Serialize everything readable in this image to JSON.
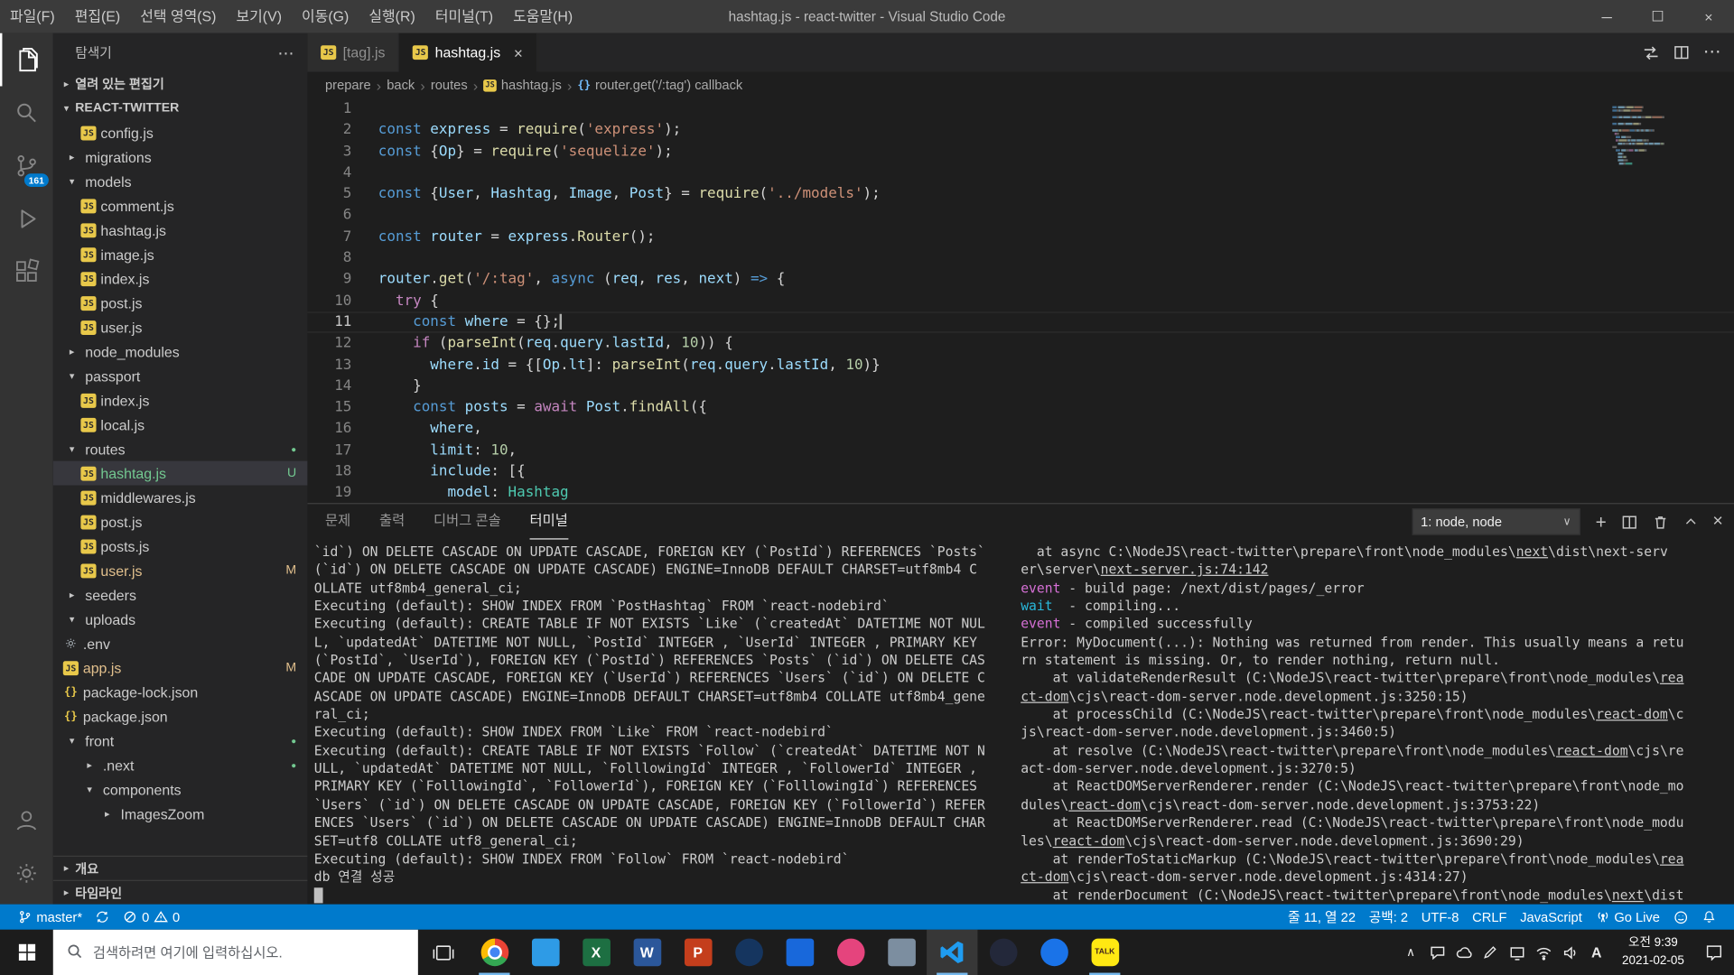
{
  "colors": {
    "accent": "#007acc",
    "untracked": "#73c991",
    "modified": "#e2c08d"
  },
  "title_bar": {
    "menus": [
      "파일(F)",
      "편집(E)",
      "선택 영역(S)",
      "보기(V)",
      "이동(G)",
      "실행(R)",
      "터미널(T)",
      "도움말(H)"
    ],
    "title": "hashtag.js - react-twitter - Visual Studio Code",
    "window_controls": [
      "minimize",
      "maximize",
      "close"
    ]
  },
  "activity_bar": {
    "items": [
      {
        "name": "explorer",
        "active": true
      },
      {
        "name": "search"
      },
      {
        "name": "source-control",
        "badge": "161"
      },
      {
        "name": "run-and-debug"
      },
      {
        "name": "extensions"
      }
    ],
    "bottom": [
      {
        "name": "account"
      },
      {
        "name": "manage"
      }
    ]
  },
  "sidebar": {
    "title": "탐색기",
    "sections": {
      "open_editors": "열려 있는 편집기",
      "outline": "개요",
      "timeline": "타임라인"
    },
    "root": "REACT-TWITTER",
    "tree": [
      {
        "label": "config.js",
        "icon": "js",
        "indent": 2
      },
      {
        "label": "migrations",
        "chevron": "collapsed",
        "indent": 1
      },
      {
        "label": "models",
        "chevron": "expanded",
        "indent": 1
      },
      {
        "label": "comment.js",
        "icon": "js",
        "indent": 2
      },
      {
        "label": "hashtag.js",
        "icon": "js",
        "indent": 2
      },
      {
        "label": "image.js",
        "icon": "js",
        "indent": 2
      },
      {
        "label": "index.js",
        "icon": "js",
        "indent": 2
      },
      {
        "label": "post.js",
        "icon": "js",
        "indent": 2
      },
      {
        "label": "user.js",
        "icon": "js",
        "indent": 2
      },
      {
        "label": "node_modules",
        "chevron": "collapsed",
        "indent": 1
      },
      {
        "label": "passport",
        "chevron": "expanded",
        "indent": 1
      },
      {
        "label": "index.js",
        "icon": "js",
        "indent": 2
      },
      {
        "label": "local.js",
        "icon": "js",
        "indent": 2
      },
      {
        "label": "routes",
        "chevron": "expanded",
        "indent": 1,
        "dot": true
      },
      {
        "label": "hashtag.js",
        "icon": "js",
        "indent": 2,
        "selected": true,
        "badge": "U",
        "state": "untracked"
      },
      {
        "label": "middlewares.js",
        "icon": "js",
        "indent": 2
      },
      {
        "label": "post.js",
        "icon": "js",
        "indent": 2
      },
      {
        "label": "posts.js",
        "icon": "js",
        "indent": 2
      },
      {
        "label": "user.js",
        "icon": "js",
        "indent": 2,
        "badge": "M",
        "state": "modified"
      },
      {
        "label": "seeders",
        "chevron": "collapsed",
        "indent": 1
      },
      {
        "label": "uploads",
        "chevron": "expanded",
        "indent": 1
      },
      {
        "label": ".env",
        "icon": "gear",
        "indent": 1
      },
      {
        "label": "app.js",
        "icon": "js",
        "indent": 1,
        "badge": "M",
        "state": "modified"
      },
      {
        "label": "package-lock.json",
        "icon": "json",
        "indent": 1
      },
      {
        "label": "package.json",
        "icon": "json",
        "indent": 1
      },
      {
        "label": "front",
        "chevron": "expanded",
        "indent": 1,
        "dot": true
      },
      {
        "label": ".next",
        "chevron": "collapsed",
        "indent": 2,
        "dot": true
      },
      {
        "label": "components",
        "chevron": "expanded",
        "indent": 2
      },
      {
        "label": "ImagesZoom",
        "chevron": "collapsed",
        "indent": 3
      }
    ]
  },
  "editor": {
    "tabs": [
      {
        "label": "[tag].js",
        "active": false
      },
      {
        "label": "hashtag.js",
        "active": true,
        "close": "×"
      }
    ],
    "actions": [
      "open-changes",
      "split-editor",
      "more-actions"
    ],
    "breadcrumbs": [
      {
        "label": "prepare"
      },
      {
        "label": "back"
      },
      {
        "label": "routes"
      },
      {
        "label": "hashtag.js",
        "icon": "js"
      },
      {
        "label": "router.get('/:tag') callback",
        "icon": "symbol"
      }
    ],
    "cursor_line": 11,
    "lines": [
      [],
      [
        [
          "k",
          "const"
        ],
        [
          "p",
          " "
        ],
        [
          "v",
          "express"
        ],
        [
          "p",
          " = "
        ],
        [
          "f",
          "require"
        ],
        [
          "p",
          "("
        ],
        [
          "s",
          "'express'"
        ],
        [
          "p",
          ");"
        ]
      ],
      [
        [
          "k",
          "const"
        ],
        [
          "p",
          " {"
        ],
        [
          "v",
          "Op"
        ],
        [
          "p",
          "} = "
        ],
        [
          "f",
          "require"
        ],
        [
          "p",
          "("
        ],
        [
          "s",
          "'sequelize'"
        ],
        [
          "p",
          ");"
        ]
      ],
      [],
      [
        [
          "k",
          "const"
        ],
        [
          "p",
          " {"
        ],
        [
          "v",
          "User"
        ],
        [
          "p",
          ", "
        ],
        [
          "v",
          "Hashtag"
        ],
        [
          "p",
          ", "
        ],
        [
          "v",
          "Image"
        ],
        [
          "p",
          ", "
        ],
        [
          "v",
          "Post"
        ],
        [
          "p",
          "} = "
        ],
        [
          "f",
          "require"
        ],
        [
          "p",
          "("
        ],
        [
          "s",
          "'../models'"
        ],
        [
          "p",
          ");"
        ]
      ],
      [],
      [
        [
          "k",
          "const"
        ],
        [
          "p",
          " "
        ],
        [
          "v",
          "router"
        ],
        [
          "p",
          " = "
        ],
        [
          "v",
          "express"
        ],
        [
          "p",
          "."
        ],
        [
          "f",
          "Router"
        ],
        [
          "p",
          "();"
        ]
      ],
      [],
      [
        [
          "v",
          "router"
        ],
        [
          "p",
          "."
        ],
        [
          "f",
          "get"
        ],
        [
          "p",
          "("
        ],
        [
          "s",
          "'/:tag'"
        ],
        [
          "p",
          ", "
        ],
        [
          "k",
          "async"
        ],
        [
          "p",
          " ("
        ],
        [
          "v",
          "req"
        ],
        [
          "p",
          ", "
        ],
        [
          "v",
          "res"
        ],
        [
          "p",
          ", "
        ],
        [
          "v",
          "next"
        ],
        [
          "p",
          ") "
        ],
        [
          "k",
          "=>"
        ],
        [
          "p",
          " {"
        ]
      ],
      [
        [
          "p",
          "  "
        ],
        [
          "c",
          "try"
        ],
        [
          "p",
          " {"
        ]
      ],
      [
        [
          "p",
          "    "
        ],
        [
          "k",
          "const"
        ],
        [
          "p",
          " "
        ],
        [
          "v",
          "where"
        ],
        [
          "p",
          " = {};"
        ]
      ],
      [
        [
          "p",
          "    "
        ],
        [
          "c",
          "if"
        ],
        [
          "p",
          " ("
        ],
        [
          "f",
          "parseInt"
        ],
        [
          "p",
          "("
        ],
        [
          "v",
          "req"
        ],
        [
          "p",
          "."
        ],
        [
          "v",
          "query"
        ],
        [
          "p",
          "."
        ],
        [
          "v",
          "lastId"
        ],
        [
          "p",
          ", "
        ],
        [
          "n",
          "10"
        ],
        [
          "p",
          ")) {"
        ]
      ],
      [
        [
          "p",
          "      "
        ],
        [
          "v",
          "where"
        ],
        [
          "p",
          "."
        ],
        [
          "v",
          "id"
        ],
        [
          "p",
          " = {["
        ],
        [
          "v",
          "Op"
        ],
        [
          "p",
          "."
        ],
        [
          "v",
          "lt"
        ],
        [
          "p",
          "]: "
        ],
        [
          "f",
          "parseInt"
        ],
        [
          "p",
          "("
        ],
        [
          "v",
          "req"
        ],
        [
          "p",
          "."
        ],
        [
          "v",
          "query"
        ],
        [
          "p",
          "."
        ],
        [
          "v",
          "lastId"
        ],
        [
          "p",
          ", "
        ],
        [
          "n",
          "10"
        ],
        [
          "p",
          ")}"
        ]
      ],
      [
        [
          "p",
          "    }"
        ]
      ],
      [
        [
          "p",
          "    "
        ],
        [
          "k",
          "const"
        ],
        [
          "p",
          " "
        ],
        [
          "v",
          "posts"
        ],
        [
          "p",
          " = "
        ],
        [
          "c",
          "await"
        ],
        [
          "p",
          " "
        ],
        [
          "v",
          "Post"
        ],
        [
          "p",
          "."
        ],
        [
          "f",
          "findAll"
        ],
        [
          "p",
          "({"
        ]
      ],
      [
        [
          "p",
          "      "
        ],
        [
          "v",
          "where"
        ],
        [
          "p",
          ","
        ]
      ],
      [
        [
          "p",
          "      "
        ],
        [
          "v",
          "limit"
        ],
        [
          "p",
          ": "
        ],
        [
          "n",
          "10"
        ],
        [
          "p",
          ","
        ]
      ],
      [
        [
          "p",
          "      "
        ],
        [
          "v",
          "include"
        ],
        [
          "p",
          ": [{"
        ]
      ],
      [
        [
          "p",
          "        "
        ],
        [
          "v",
          "model"
        ],
        [
          "p",
          ": "
        ],
        [
          "t",
          "Hashtag"
        ]
      ]
    ]
  },
  "panel": {
    "tabs": [
      {
        "label": "문제"
      },
      {
        "label": "출력"
      },
      {
        "label": "디버그 콘솔"
      },
      {
        "label": "터미널"
      }
    ],
    "active_tab": "터미널",
    "terminal_selector": "1: node, node",
    "actions": [
      "new-terminal",
      "split-terminal",
      "kill-terminal",
      "maximize-panel",
      "close-panel"
    ],
    "terminal_left": [
      "`id`) ON DELETE CASCADE ON UPDATE CASCADE, FOREIGN KEY (`PostId`) REFERENCES `Posts`",
      "(`id`) ON DELETE CASCADE ON UPDATE CASCADE) ENGINE=InnoDB DEFAULT CHARSET=utf8mb4 C",
      "OLLATE utf8mb4_general_ci;",
      "Executing (default): SHOW INDEX FROM `PostHashtag` FROM `react-nodebird`",
      "Executing (default): CREATE TABLE IF NOT EXISTS `Like` (`createdAt` DATETIME NOT NUL",
      "L, `updatedAt` DATETIME NOT NULL, `PostId` INTEGER , `UserId` INTEGER , PRIMARY KEY",
      "(`PostId`, `UserId`), FOREIGN KEY (`PostId`) REFERENCES `Posts` (`id`) ON DELETE CAS",
      "CADE ON UPDATE CASCADE, FOREIGN KEY (`UserId`) REFERENCES `Users` (`id`) ON DELETE C",
      "ASCADE ON UPDATE CASCADE) ENGINE=InnoDB DEFAULT CHARSET=utf8mb4 COLLATE utf8mb4_gene",
      "ral_ci;",
      "Executing (default): SHOW INDEX FROM `Like` FROM `react-nodebird`",
      "Executing (default): CREATE TABLE IF NOT EXISTS `Follow` (`createdAt` DATETIME NOT N",
      "ULL, `updatedAt` DATETIME NOT NULL, `FolllowingId` INTEGER , `FollowerId` INTEGER ,",
      "PRIMARY KEY (`FolllowingId`, `FollowerId`), FOREIGN KEY (`FolllowingId`) REFERENCES",
      "`Users` (`id`) ON DELETE CASCADE ON UPDATE CASCADE, FOREIGN KEY (`FollowerId`) REFER",
      "ENCES `Users` (`id`) ON DELETE CASCADE ON UPDATE CASCADE) ENGINE=InnoDB DEFAULT CHAR",
      "SET=utf8 COLLATE utf8_general_ci;",
      "Executing (default): SHOW INDEX FROM `Follow` FROM `react-nodebird`",
      "db 연결 성공"
    ],
    "terminal_right": [
      [
        [
          "d",
          "  at async C:\\NodeJS\\react-twitter\\prepare\\front\\node_modules\\"
        ],
        [
          "u",
          "next"
        ],
        [
          "d",
          "\\dist\\next-serv"
        ]
      ],
      [
        [
          "d",
          "er\\server\\"
        ],
        [
          "u",
          "next-server.js:74:142"
        ]
      ],
      [
        [
          "m",
          "event"
        ],
        [
          "d",
          " - build page: /next/dist/pages/_error"
        ]
      ],
      [
        [
          "c",
          "wait"
        ],
        [
          "d",
          "  - compiling..."
        ]
      ],
      [
        [
          "m",
          "event"
        ],
        [
          "d",
          " - compiled successfully"
        ]
      ],
      [
        [
          "d",
          "Error: MyDocument(...): Nothing was returned from render. This usually means a retu"
        ]
      ],
      [
        [
          "d",
          "rn statement is missing. Or, to render nothing, return null."
        ]
      ],
      [
        [
          "d",
          "    at validateRenderResult (C:\\NodeJS\\react-twitter\\prepare\\front\\node_modules\\"
        ],
        [
          "u",
          "rea"
        ]
      ],
      [
        [
          "u",
          "ct-dom"
        ],
        [
          "d",
          "\\cjs\\react-dom-server.node.development.js:3250:15)"
        ]
      ],
      [
        [
          "d",
          "    at processChild (C:\\NodeJS\\react-twitter\\prepare\\front\\node_modules\\"
        ],
        [
          "u",
          "react-dom"
        ],
        [
          "d",
          "\\c"
        ]
      ],
      [
        [
          "d",
          "js\\react-dom-server.node.development.js:3460:5)"
        ]
      ],
      [
        [
          "d",
          "    at resolve (C:\\NodeJS\\react-twitter\\prepare\\front\\node_modules\\"
        ],
        [
          "u",
          "react-dom"
        ],
        [
          "d",
          "\\cjs\\re"
        ]
      ],
      [
        [
          "d",
          "act-dom-server.node.development.js:3270:5)"
        ]
      ],
      [
        [
          "d",
          "    at ReactDOMServerRenderer.render (C:\\NodeJS\\react-twitter\\prepare\\front\\node_mo"
        ]
      ],
      [
        [
          "d",
          "dules\\"
        ],
        [
          "u",
          "react-dom"
        ],
        [
          "d",
          "\\cjs\\react-dom-server.node.development.js:3753:22)"
        ]
      ],
      [
        [
          "d",
          "    at ReactDOMServerRenderer.read (C:\\NodeJS\\react-twitter\\prepare\\front\\node_modu"
        ]
      ],
      [
        [
          "d",
          "les\\"
        ],
        [
          "u",
          "react-dom"
        ],
        [
          "d",
          "\\cjs\\react-dom-server.node.development.js:3690:29)"
        ]
      ],
      [
        [
          "d",
          "    at renderToStaticMarkup (C:\\NodeJS\\react-twitter\\prepare\\front\\node_modules\\"
        ],
        [
          "u",
          "rea"
        ]
      ],
      [
        [
          "u",
          "ct-dom"
        ],
        [
          "d",
          "\\cjs\\react-dom-server.node.development.js:4314:27)"
        ]
      ],
      [
        [
          "d",
          "    at renderDocument (C:\\NodeJS\\react-twitter\\prepare\\front\\node_modules\\"
        ],
        [
          "u",
          "next"
        ],
        [
          "d",
          "\\dist"
        ]
      ]
    ]
  },
  "status_bar": {
    "branch": "master*",
    "errors": "0",
    "warnings": "0",
    "items_right": [
      {
        "name": "cursor-position",
        "label": "줄 11, 열 22"
      },
      {
        "name": "indentation",
        "label": "공백: 2"
      },
      {
        "name": "encoding",
        "label": "UTF-8"
      },
      {
        "name": "eol",
        "label": "CRLF"
      },
      {
        "name": "language-mode",
        "label": "JavaScript"
      },
      {
        "name": "go-live",
        "label": "Go Live"
      }
    ]
  },
  "taskbar": {
    "search_placeholder": "검색하려면 여기에 입력하십시오.",
    "apps": [
      {
        "name": "task-view",
        "kind": "taskview"
      },
      {
        "name": "chrome",
        "kind": "chrome",
        "running": true
      },
      {
        "name": "app-blue",
        "kind": "tile",
        "bg": "#2e9be6"
      },
      {
        "name": "excel",
        "kind": "tile",
        "bg": "#1d6f42",
        "letter": "X"
      },
      {
        "name": "word",
        "kind": "tile",
        "bg": "#2b579a",
        "letter": "W"
      },
      {
        "name": "powerpoint",
        "kind": "tile",
        "bg": "#c43e1c",
        "letter": "P"
      },
      {
        "name": "app-navy",
        "kind": "circle",
        "bg": "#15355f"
      },
      {
        "name": "app-blue-2",
        "kind": "tile",
        "bg": "#1868db"
      },
      {
        "name": "app-pink",
        "kind": "circle",
        "bg": "#e5447d"
      },
      {
        "name": "app-gray",
        "kind": "tile",
        "bg": "#7c8ea0"
      },
      {
        "name": "vscode",
        "kind": "vscode",
        "running": true,
        "focused": true
      },
      {
        "name": "app-dark",
        "kind": "circle",
        "bg": "#23283a"
      },
      {
        "name": "app-map",
        "kind": "circle",
        "bg": "#1a73e8"
      },
      {
        "name": "kakaotalk",
        "kind": "kakao",
        "label": "TALK",
        "running": true
      }
    ],
    "tray": [
      "tray-expand",
      "tray-chat",
      "tray-cloud",
      "tray-pen",
      "tray-display",
      "tray-network",
      "tray-volume",
      "ime-korean"
    ],
    "clock": {
      "time": "오전 9:39",
      "date": "2021-02-05"
    }
  }
}
